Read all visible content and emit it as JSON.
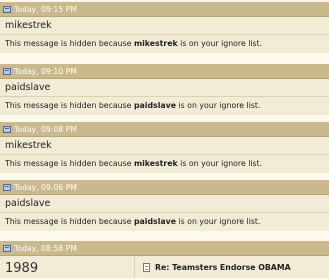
{
  "posts": [
    {
      "date": "Today, 09:15 PM",
      "username": "mikestrek",
      "msg_prefix": "This message is hidden because ",
      "msg_user": "mikestrek",
      "msg_suffix": " is on your ignore list."
    },
    {
      "date": "Today, 09:10 PM",
      "username": "paidslave",
      "msg_prefix": "This message is hidden because ",
      "msg_user": "paidslave",
      "msg_suffix": " is on your ignore list."
    },
    {
      "date": "Today, 09:08 PM",
      "username": "mikestrek",
      "msg_prefix": "This message is hidden because ",
      "msg_user": "mikestrek",
      "msg_suffix": " is on your ignore list."
    },
    {
      "date": "Today, 09:06 PM",
      "username": "paidslave",
      "msg_prefix": "This message is hidden because ",
      "msg_user": "paidslave",
      "msg_suffix": " is on your ignore list."
    }
  ],
  "last_post": {
    "date": "Today, 08:58 PM",
    "username": "1989",
    "title": "Re: Teamsters Endorse OBAMA"
  }
}
